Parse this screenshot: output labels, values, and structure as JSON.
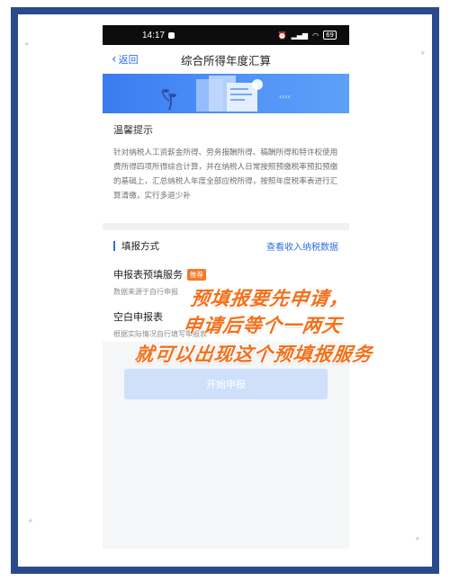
{
  "status_bar": {
    "time": "14:17",
    "battery": "69"
  },
  "nav": {
    "back_label": "返回",
    "title": "综合所得年度汇算"
  },
  "notice": {
    "title": "温馨提示",
    "text": "针对纳税人工资薪金所得、劳务报酬所得、稿酬所得和特许权使用费所得四项所得综合计算，并在纳税人日常按照预缴税率预扣预缴的基础上，汇总纳税人年度全部应税所得，按照年度税率表进行汇算清缴，实行多退少补"
  },
  "method": {
    "title": "填报方式",
    "link": "查看收入纳税数据",
    "options": [
      {
        "title": "申报表预填服务",
        "tag": "推荐",
        "desc": "数据来源于自行申报"
      },
      {
        "title": "空白申报表",
        "desc": "根据实际情况自行填写申报表"
      }
    ]
  },
  "start_button": "开始申报",
  "overlay": {
    "line1": "预填报要先申请，",
    "line2": "申请后等个一两天",
    "line3": "就可以出现这个预填报服务"
  },
  "colors": {
    "frame": "#2a4a8c",
    "accent": "#2f6fe0",
    "overlay_text": "#f4701a",
    "tag": "#f47a2a"
  }
}
